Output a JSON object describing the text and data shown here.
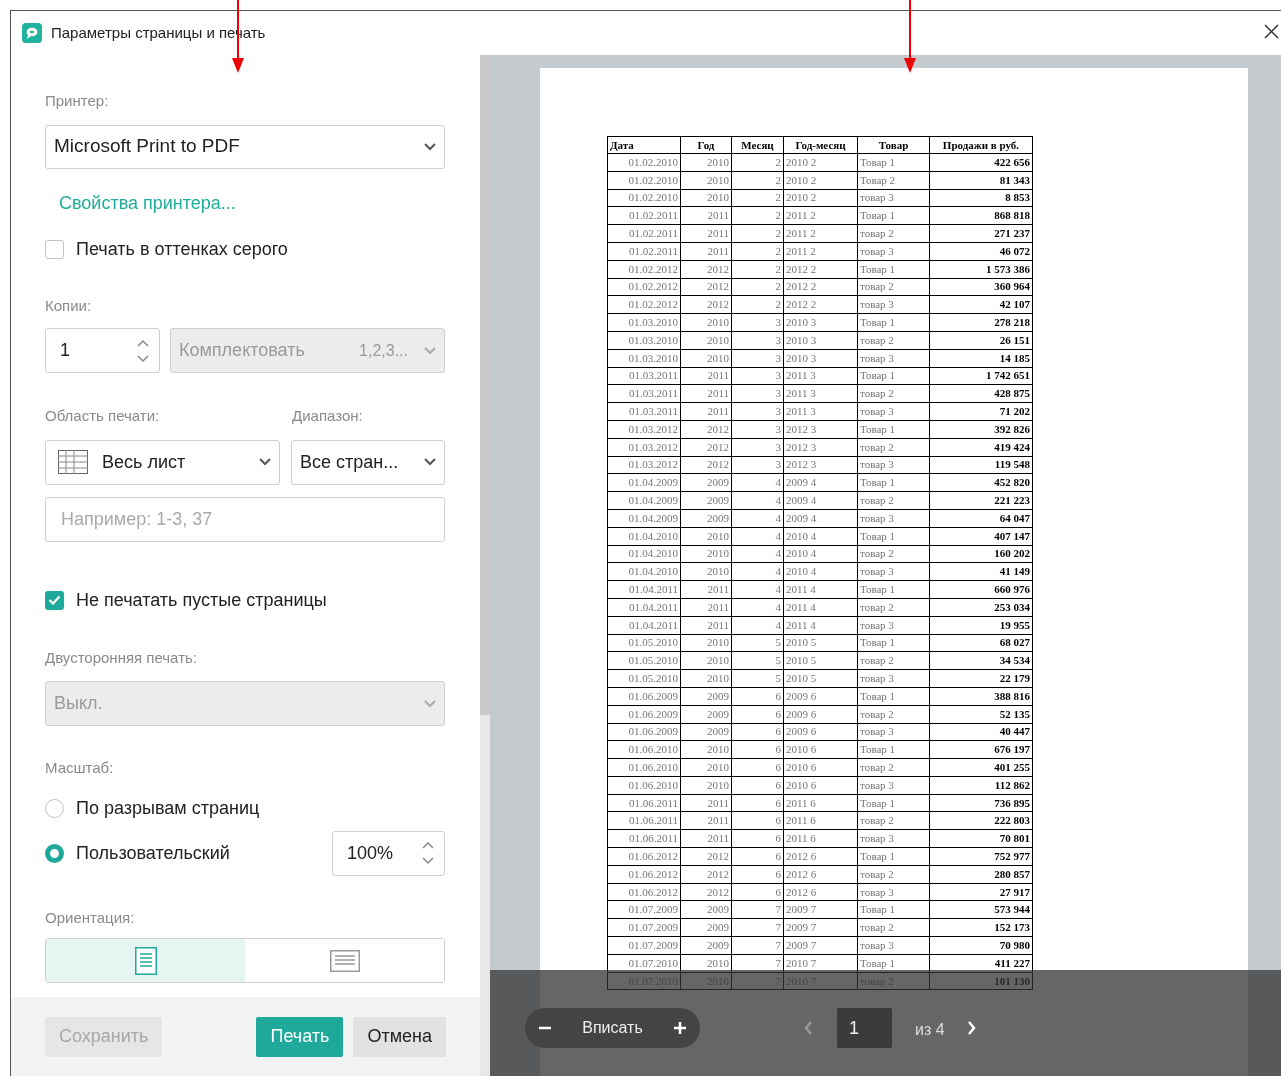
{
  "window": {
    "title": "Параметры страницы и печать"
  },
  "settings": {
    "printer_label": "Принтер:",
    "printer": "Microsoft Print to PDF",
    "printer_properties_link": "Свойства принтера...",
    "grayscale": {
      "label": "Печать в оттенках серого",
      "checked": false
    },
    "copies_label": "Копии:",
    "copies": "1",
    "collate": {
      "label": "Комплектовать",
      "hint": "1,2,3...",
      "disabled": true
    },
    "print_area_label": "Область печати:",
    "print_area": "Весь лист",
    "range_label": "Диапазон:",
    "range": "Все стран...",
    "pages_placeholder": "Например: 1-3, 37",
    "skip_blank": {
      "label": "Не печатать пустые страницы",
      "checked": true
    },
    "duplex_label": "Двусторонняя печать:",
    "duplex": {
      "value": "Выкл.",
      "disabled": true
    },
    "scale_label": "Масштаб:",
    "scale_options": [
      {
        "label": "По разрывам страниц",
        "selected": false
      },
      {
        "label": "Пользовательский",
        "selected": true
      }
    ],
    "scale_value": "100%",
    "orientation_label": "Ориентация:",
    "orientation": [
      {
        "kind": "portrait",
        "selected": true
      },
      {
        "kind": "landscape",
        "selected": false
      }
    ]
  },
  "buttons": [
    {
      "label": "Сохранить",
      "primary": false,
      "disabled": true
    },
    {
      "label": "Печать",
      "primary": true,
      "disabled": false
    },
    {
      "label": "Отмена",
      "primary": false,
      "disabled": false
    }
  ],
  "preview": {
    "table": {
      "columns": [
        "Дата",
        "Год",
        "Месяц",
        "Год-месяц",
        "Товар",
        "Продажи в руб."
      ],
      "rows": [
        [
          "01.02.2010",
          "2010",
          "2",
          "2010 2",
          "Товар 1",
          "422 656"
        ],
        [
          "01.02.2010",
          "2010",
          "2",
          "2010 2",
          "Товар 2",
          "81 343"
        ],
        [
          "01.02.2010",
          "2010",
          "2",
          "2010 2",
          "товар 3",
          "8 853"
        ],
        [
          "01.02.2011",
          "2011",
          "2",
          "2011 2",
          "Товар 1",
          "868 818"
        ],
        [
          "01.02.2011",
          "2011",
          "2",
          "2011 2",
          "товар 2",
          "271 237"
        ],
        [
          "01.02.2011",
          "2011",
          "2",
          "2011 2",
          "товар 3",
          "46 072"
        ],
        [
          "01.02.2012",
          "2012",
          "2",
          "2012 2",
          "Товар 1",
          "1 573 386"
        ],
        [
          "01.02.2012",
          "2012",
          "2",
          "2012 2",
          "товар 2",
          "360 964"
        ],
        [
          "01.02.2012",
          "2012",
          "2",
          "2012 2",
          "товар 3",
          "42 107"
        ],
        [
          "01.03.2010",
          "2010",
          "3",
          "2010 3",
          "Товар 1",
          "278 218"
        ],
        [
          "01.03.2010",
          "2010",
          "3",
          "2010 3",
          "товар 2",
          "26 151"
        ],
        [
          "01.03.2010",
          "2010",
          "3",
          "2010 3",
          "товар 3",
          "14 185"
        ],
        [
          "01.03.2011",
          "2011",
          "3",
          "2011 3",
          "Товар 1",
          "1 742 651"
        ],
        [
          "01.03.2011",
          "2011",
          "3",
          "2011 3",
          "товар 2",
          "428 875"
        ],
        [
          "01.03.2011",
          "2011",
          "3",
          "2011 3",
          "товар 3",
          "71 202"
        ],
        [
          "01.03.2012",
          "2012",
          "3",
          "2012 3",
          "Товар 1",
          "392 826"
        ],
        [
          "01.03.2012",
          "2012",
          "3",
          "2012 3",
          "товар 2",
          "419 424"
        ],
        [
          "01.03.2012",
          "2012",
          "3",
          "2012 3",
          "товар 3",
          "119 548"
        ],
        [
          "01.04.2009",
          "2009",
          "4",
          "2009 4",
          "Товар 1",
          "452 820"
        ],
        [
          "01.04.2009",
          "2009",
          "4",
          "2009 4",
          "товар 2",
          "221 223"
        ],
        [
          "01.04.2009",
          "2009",
          "4",
          "2009 4",
          "товар 3",
          "64 047"
        ],
        [
          "01.04.2010",
          "2010",
          "4",
          "2010 4",
          "Товар 1",
          "407 147"
        ],
        [
          "01.04.2010",
          "2010",
          "4",
          "2010 4",
          "товар 2",
          "160 202"
        ],
        [
          "01.04.2010",
          "2010",
          "4",
          "2010 4",
          "товар 3",
          "41 149"
        ],
        [
          "01.04.2011",
          "2011",
          "4",
          "2011 4",
          "Товар 1",
          "660 976"
        ],
        [
          "01.04.2011",
          "2011",
          "4",
          "2011 4",
          "товар 2",
          "253 034"
        ],
        [
          "01.04.2011",
          "2011",
          "4",
          "2011 4",
          "товар 3",
          "19 955"
        ],
        [
          "01.05.2010",
          "2010",
          "5",
          "2010 5",
          "Товар 1",
          "68 027"
        ],
        [
          "01.05.2010",
          "2010",
          "5",
          "2010 5",
          "товар 2",
          "34 534"
        ],
        [
          "01.05.2010",
          "2010",
          "5",
          "2010 5",
          "товар 3",
          "22 179"
        ],
        [
          "01.06.2009",
          "2009",
          "6",
          "2009 6",
          "Товар 1",
          "388 816"
        ],
        [
          "01.06.2009",
          "2009",
          "6",
          "2009 6",
          "товар 2",
          "52 135"
        ],
        [
          "01.06.2009",
          "2009",
          "6",
          "2009 6",
          "товар 3",
          "40 447"
        ],
        [
          "01.06.2010",
          "2010",
          "6",
          "2010 6",
          "Товар 1",
          "676 197"
        ],
        [
          "01.06.2010",
          "2010",
          "6",
          "2010 6",
          "товар 2",
          "401 255"
        ],
        [
          "01.06.2010",
          "2010",
          "6",
          "2010 6",
          "товар 3",
          "112 862"
        ],
        [
          "01.06.2011",
          "2011",
          "6",
          "2011 6",
          "Товар 1",
          "736 895"
        ],
        [
          "01.06.2011",
          "2011",
          "6",
          "2011 6",
          "товар 2",
          "222 803"
        ],
        [
          "01.06.2011",
          "2011",
          "6",
          "2011 6",
          "товар 3",
          "70 801"
        ],
        [
          "01.06.2012",
          "2012",
          "6",
          "2012 6",
          "Товар 1",
          "752 977"
        ],
        [
          "01.06.2012",
          "2012",
          "6",
          "2012 6",
          "товар 2",
          "280 857"
        ],
        [
          "01.06.2012",
          "2012",
          "6",
          "2012 6",
          "товар 3",
          "27 917"
        ],
        [
          "01.07.2009",
          "2009",
          "7",
          "2009 7",
          "Товар 1",
          "573 944"
        ],
        [
          "01.07.2009",
          "2009",
          "7",
          "2009 7",
          "товар 2",
          "152 173"
        ],
        [
          "01.07.2009",
          "2009",
          "7",
          "2009 7",
          "товар 3",
          "70 980"
        ],
        [
          "01.07.2010",
          "2010",
          "7",
          "2010 7",
          "Товар 1",
          "411 227"
        ],
        [
          "01.07.2010",
          "2010",
          "7",
          "2010 7",
          "товар 2",
          "101 130"
        ]
      ]
    },
    "zoom_label": "Вписать",
    "page": "1",
    "page_count": "из 4"
  }
}
